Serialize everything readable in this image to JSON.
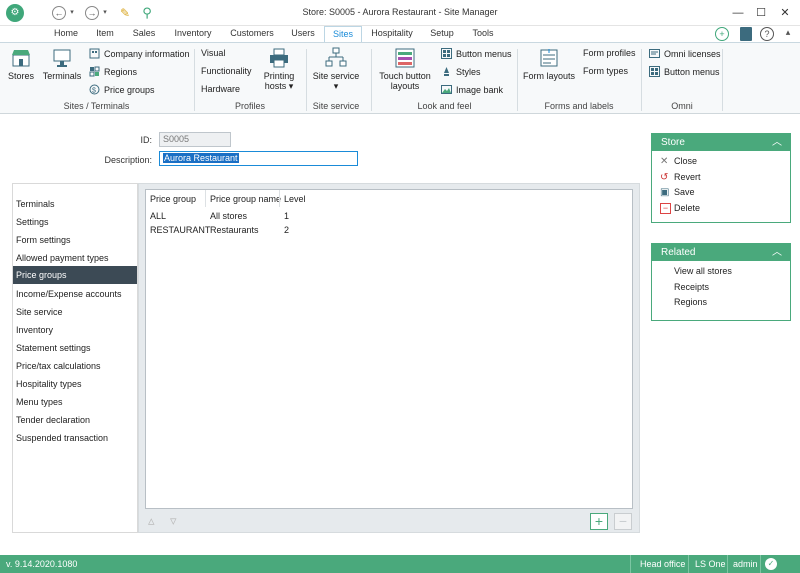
{
  "window": {
    "title": "Store: S0005 - Aurora Restaurant - Site Manager",
    "minimize": "—",
    "maximize": "☐",
    "close": "✕"
  },
  "quickaccess": {
    "back": "←",
    "forward": "→",
    "notes": "✎",
    "search": "⚲"
  },
  "tabs": [
    "Home",
    "Item",
    "Sales",
    "Inventory",
    "Customers",
    "Users",
    "Sites",
    "Hospitality",
    "Setup",
    "Tools"
  ],
  "ribbon": {
    "stores": "Stores",
    "terminals": "Terminals",
    "company_information": "Company information",
    "regions": "Regions",
    "price_groups": "Price groups",
    "group_sites_terminals": "Sites / Terminals",
    "visual": "Visual",
    "functionality": "Functionality",
    "hardware": "Hardware",
    "printing_hosts_1": "Printing",
    "printing_hosts_2": "hosts",
    "group_profiles": "Profiles",
    "site_service": "Site service",
    "group_site_service": "Site service",
    "touch_button_layouts_1": "Touch button",
    "touch_button_layouts_2": "layouts",
    "button_menus": "Button menus",
    "styles": "Styles",
    "image_bank": "Image bank",
    "group_look_and_feel": "Look and feel",
    "form_layouts": "Form layouts",
    "form_profiles": "Form profiles",
    "form_types": "Form types",
    "group_forms_and_labels": "Forms and labels",
    "omni_licenses": "Omni licenses",
    "omni_button_menus": "Button menus",
    "group_omni": "Omni"
  },
  "form": {
    "id_label": "ID:",
    "id_value": "S0005",
    "description_label": "Description:",
    "description_value": "Aurora Restaurant"
  },
  "leftnav": {
    "items": [
      "Terminals",
      "Settings",
      "Form settings",
      "Allowed payment types",
      "Price groups",
      "Income/Expense accounts",
      "Site service",
      "Inventory",
      "Statement settings",
      "Price/tax calculations",
      "Hospitality types",
      "Menu types",
      "Tender declaration",
      "Suspended transaction"
    ],
    "selected": "Price groups"
  },
  "grid": {
    "columns": [
      "Price group",
      "Price group name",
      "Level"
    ],
    "rows": [
      [
        "ALL",
        "All stores",
        "1"
      ],
      [
        "RESTAURANT",
        "Restaurants",
        "2"
      ]
    ]
  },
  "store_panel": {
    "title": "Store",
    "items": [
      "Close",
      "Revert",
      "Save",
      "Delete"
    ]
  },
  "related_panel": {
    "title": "Related",
    "items": [
      "View all stores",
      "Receipts",
      "Regions"
    ]
  },
  "statusbar": {
    "version": "v. 9.14.2020.1080",
    "location": "Head office",
    "product": "LS One",
    "user": "admin"
  },
  "colors": {
    "accent": "#4aa97c",
    "tab_active": "#1a8bd8",
    "nav_selected": "#3c4a55"
  }
}
